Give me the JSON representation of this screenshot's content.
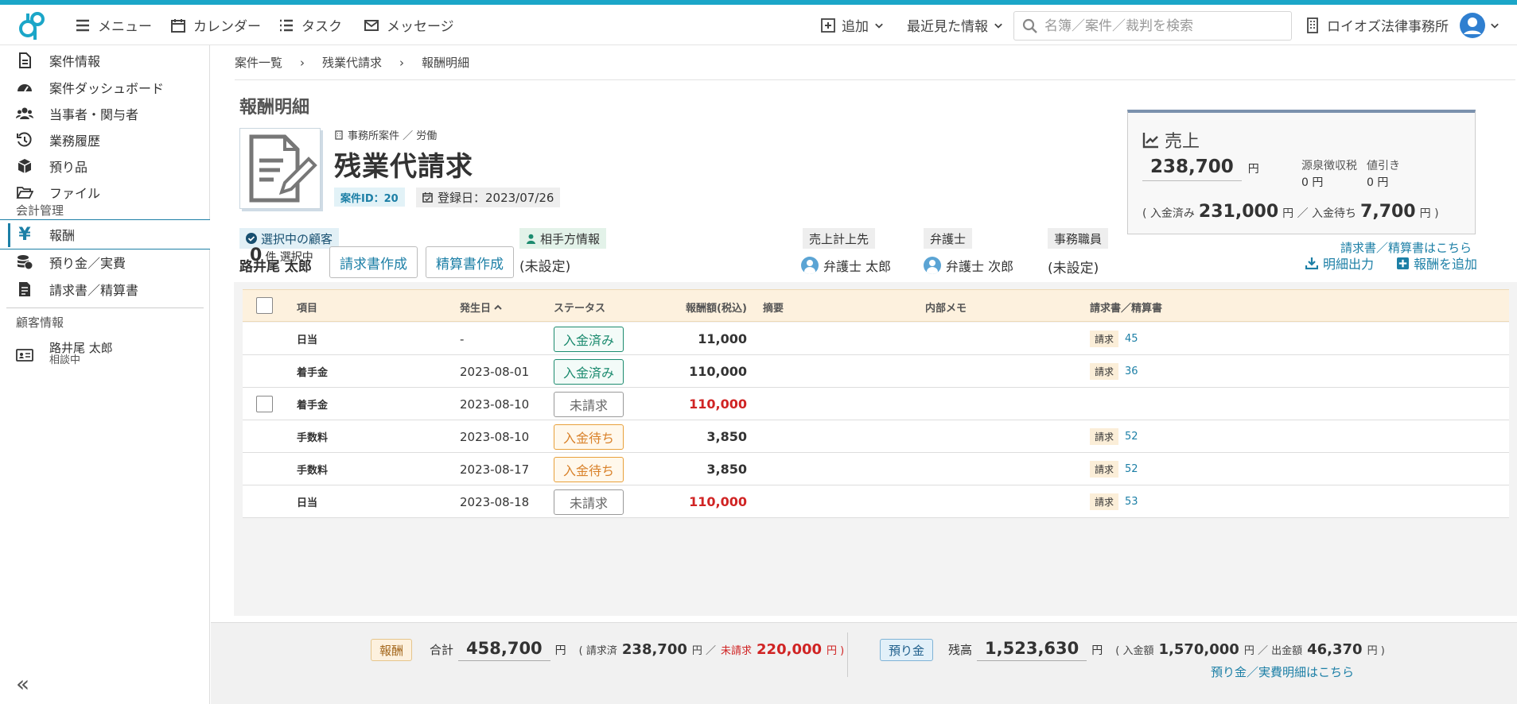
{
  "header": {
    "menu": "メニュー",
    "calendar": "カレンダー",
    "task": "タスク",
    "message": "メッセージ",
    "add": "追加",
    "recent": "最近見た情報",
    "search_placeholder": "名簿／案件／裁判を検索",
    "office": "ロイオズ法律事務所"
  },
  "sidebar": {
    "items": [
      "案件情報",
      "案件ダッシュボード",
      "当事者・関与者",
      "業務履歴",
      "預り品",
      "ファイル"
    ],
    "accounting_section": "会計管理",
    "accounting_items": [
      "報酬",
      "預り金／実費",
      "請求書／精算書"
    ],
    "client_section": "顧客情報",
    "client_name": "路井尾 太郎",
    "client_status": "相談中"
  },
  "breadcrumb": [
    "案件一覧",
    "残業代請求",
    "報酬明細"
  ],
  "page_title": "報酬明細",
  "case": {
    "category": "事務所案件 ／ 労働",
    "name": "残業代請求",
    "id_label": "案件ID：20",
    "registered": "登録日：2023/07/26"
  },
  "sales": {
    "title": "売上",
    "amount": "238,700",
    "yen": "円",
    "withholding_label": "源泉徴収税",
    "withholding_value": "0 円",
    "discount_label": "値引き",
    "discount_value": "0 円",
    "paid_prefix": "( 入金済み",
    "paid_amount": "231,000",
    "paid_sep": "円 ／ 入金待ち",
    "pending_amount": "7,700",
    "paid_suffix": "円 )",
    "invoice_link": "請求書／精算書はこちら"
  },
  "info": {
    "selected_client_label": "選択中の顧客",
    "selected_client": "路井尾 太郎",
    "opponent_label": "相手方情報",
    "opponent": "(未設定)",
    "sales_to_label": "売上計上先",
    "sales_to": "弁護士 太郎",
    "lawyer_label": "弁護士",
    "lawyer": "弁護士 次郎",
    "staff_label": "事務職員",
    "staff": "(未設定)"
  },
  "toolbar": {
    "count": "0",
    "count_suffix": "件 選択中",
    "invoice_btn": "請求書作成",
    "settlement_btn": "精算書作成",
    "export": "明細出力",
    "add_fee": "報酬を追加"
  },
  "table": {
    "columns": [
      "項目",
      "発生日",
      "ステータス",
      "報酬額(税込)",
      "摘要",
      "内部メモ",
      "請求書／精算書"
    ],
    "rows": [
      {
        "item": "日当",
        "date": "-",
        "status": "入金済み",
        "status_kind": "paid",
        "amount": "11,000",
        "red": false,
        "checkbox": false,
        "inv_tag": "請求",
        "inv_no": "45"
      },
      {
        "item": "着手金",
        "date": "2023-08-01",
        "status": "入金済み",
        "status_kind": "paid",
        "amount": "110,000",
        "red": false,
        "checkbox": false,
        "inv_tag": "請求",
        "inv_no": "36"
      },
      {
        "item": "着手金",
        "date": "2023-08-10",
        "status": "未請求",
        "status_kind": "none",
        "amount": "110,000",
        "red": true,
        "checkbox": true,
        "inv_tag": "",
        "inv_no": ""
      },
      {
        "item": "手数料",
        "date": "2023-08-10",
        "status": "入金待ち",
        "status_kind": "pend",
        "amount": "3,850",
        "red": false,
        "checkbox": false,
        "inv_tag": "請求",
        "inv_no": "52"
      },
      {
        "item": "手数料",
        "date": "2023-08-17",
        "status": "入金待ち",
        "status_kind": "pend",
        "amount": "3,850",
        "red": false,
        "checkbox": false,
        "inv_tag": "請求",
        "inv_no": "52"
      },
      {
        "item": "日当",
        "date": "2023-08-18",
        "status": "未請求",
        "status_kind": "none",
        "amount": "110,000",
        "red": true,
        "checkbox": false,
        "inv_tag": "請求",
        "inv_no": "53"
      }
    ]
  },
  "footer": {
    "fee_tag": "報酬",
    "total_label": "合計",
    "total": "458,700",
    "yen": "円",
    "billed_prefix": "( 請求済",
    "billed": "238,700",
    "billed_sep": "円 ／",
    "unbilled_label": "未請求",
    "unbilled": "220,000",
    "unbilled_suffix": "円 )",
    "deposit_tag": "預り金",
    "balance_label": "残高",
    "balance": "1,523,630",
    "deposit_prefix": "( 入金額",
    "deposit_in": "1,570,000",
    "deposit_sep": "円 ／ 出金額",
    "deposit_out": "46,370",
    "deposit_suffix": "円 )",
    "deposit_link": "預り金／実費明細はこちら"
  },
  "colors": {
    "accent": "#1c7fa6",
    "top_bar": "#1ba6c8",
    "paid": "#1c8b6f",
    "pending": "#d9822b",
    "unbilled": "#d02424",
    "table_header": "#fdf1de"
  }
}
